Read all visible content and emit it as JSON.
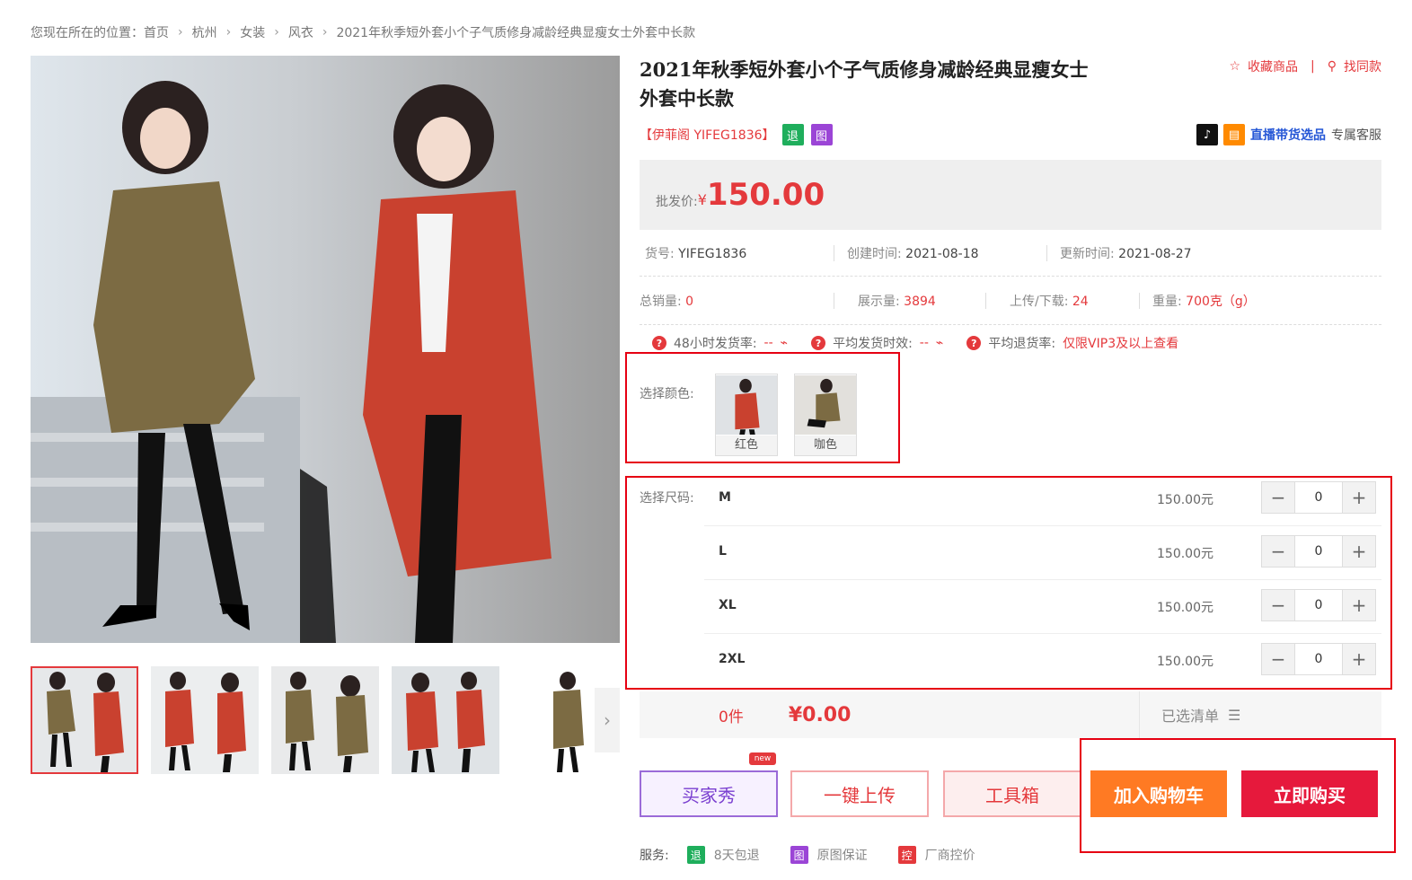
{
  "breadcrumb": {
    "prefix": "您现在所在的位置：",
    "items": [
      "首页",
      "杭州",
      "女装",
      "风衣",
      "2021年秋季短外套小个子气质修身减龄经典显瘦女士外套中长款"
    ]
  },
  "product": {
    "title": "2021年秋季短外套小个子气质修身减龄经典显瘦女士外套中长款",
    "brand": "【伊菲阁 YIFEG1836】",
    "badge_return": "退",
    "badge_image": "图"
  },
  "actions": {
    "favorite": "收藏商品",
    "find_similar": "找同款"
  },
  "live": {
    "link": "直播带货选品",
    "suffix": "专属客服"
  },
  "price": {
    "label": "批发价:",
    "currency": "¥",
    "value": "150.00"
  },
  "meta": {
    "sku_label": "货号:",
    "sku": "YIFEG1836",
    "created_label": "创建时间:",
    "created": "2021-08-18",
    "updated_label": "更新时间:",
    "updated": "2021-08-27",
    "sales_label": "总销量:",
    "sales": "0",
    "views_label": "展示量:",
    "views": "3894",
    "uploads_label": "上传/下载:",
    "uploads": "24",
    "weight_label": "重量:",
    "weight": "700克（g）"
  },
  "stats": {
    "ship48_label": "48小时发货率:",
    "ship48_value": "--",
    "avg_ship_label": "平均发货时效:",
    "avg_ship_value": "--",
    "return_label": "平均退货率:",
    "return_value": "仅限VIP3及以上查看"
  },
  "color_select": {
    "label": "选择颜色:",
    "options": [
      {
        "name": "红色"
      },
      {
        "name": "咖色"
      }
    ]
  },
  "size_select": {
    "label": "选择尺码:",
    "rows": [
      {
        "size": "M",
        "price": "150.00元",
        "qty": "0"
      },
      {
        "size": "L",
        "price": "150.00元",
        "qty": "0"
      },
      {
        "size": "XL",
        "price": "150.00元",
        "qty": "0"
      },
      {
        "size": "2XL",
        "price": "150.00元",
        "qty": "0"
      }
    ]
  },
  "summary": {
    "count": "0件",
    "total": "¥0.00",
    "selected_list": "已选清单"
  },
  "buttons": {
    "buyer_show": "买家秀",
    "new_tag": "new",
    "one_click_upload": "一键上传",
    "toolbox": "工具箱",
    "add_to_cart": "加入购物车",
    "buy_now": "立即购买"
  },
  "services": {
    "label": "服务:",
    "items": [
      {
        "badge": "退",
        "text": "8天包退"
      },
      {
        "badge": "图",
        "text": "原图保证"
      },
      {
        "badge": "控",
        "text": "厂商控价"
      }
    ]
  },
  "colors": {
    "accent": "#e4393c",
    "cart": "#ff7a23",
    "buy": "#e6193c",
    "link": "#2456d6",
    "highlight": "#e60012"
  }
}
